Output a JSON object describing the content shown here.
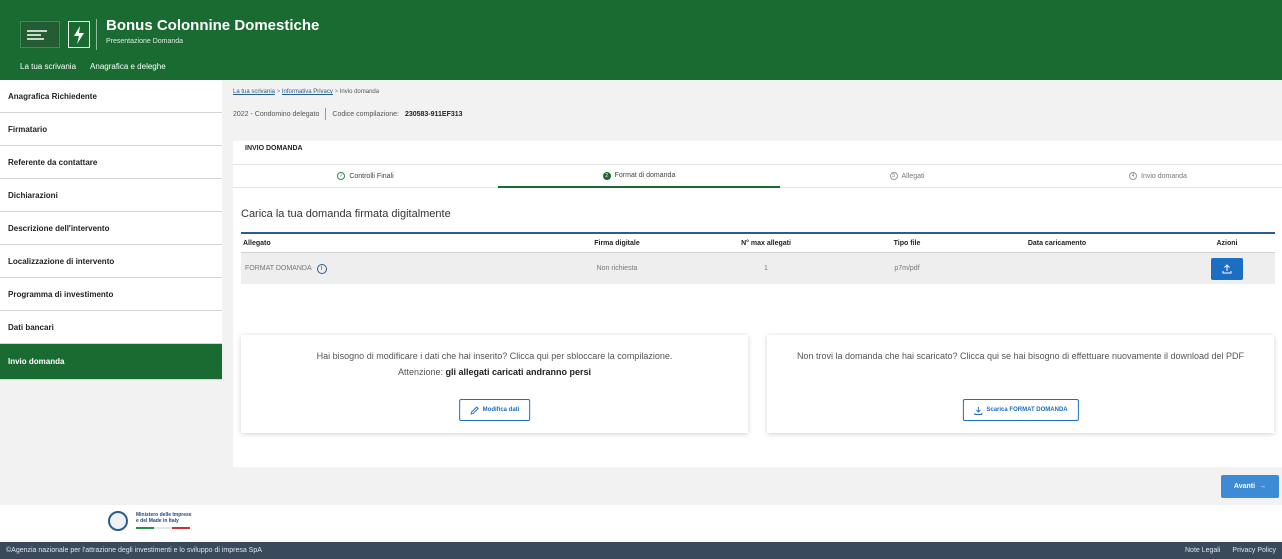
{
  "header": {
    "title": "Bonus Colonnine Domestiche",
    "subtitle": "Presentazione Domanda",
    "nav": [
      "La tua scrivania",
      "Anagrafica e deleghe"
    ]
  },
  "sidebar": {
    "items": [
      {
        "label": "Anagrafica Richiedente"
      },
      {
        "label": "Firmatario"
      },
      {
        "label": "Referente da contattare"
      },
      {
        "label": "Dichiarazioni"
      },
      {
        "label": "Descrizione dell'intervento"
      },
      {
        "label": "Localizzazione di intervento"
      },
      {
        "label": "Programma di investimento"
      },
      {
        "label": "Dati bancari"
      },
      {
        "label": "Invio domanda",
        "active": true
      }
    ]
  },
  "breadcrumb": [
    "La tua scrivania",
    "Informativa Privacy",
    "Invio domanda"
  ],
  "meta": {
    "year_type": "2022 - Condomino delegato",
    "code_label": "Codice compilazione:",
    "code_value": "230583-911EF313"
  },
  "card": {
    "title": "INVIO DOMANDA",
    "steps": [
      {
        "number": "✓",
        "label": "Controlli Finali",
        "state": "done"
      },
      {
        "number": "2",
        "label": "Format di domanda",
        "state": "active"
      },
      {
        "number": "3",
        "label": "Allegati",
        "state": "pending"
      },
      {
        "number": "4",
        "label": "Invio domanda",
        "state": "pending"
      }
    ],
    "upload_title": "Carica la tua domanda firmata digitalmente",
    "table": {
      "headers": [
        "Allegato",
        "Firma digitale",
        "N° max allegati",
        "Tipo file",
        "Data caricamento",
        "Azioni"
      ],
      "row": {
        "allegato": "FORMAT DOMANDA",
        "firma": "Non richiesta",
        "max": "1",
        "tipo": "p7m/pdf",
        "data": ""
      }
    },
    "panel_left": {
      "line1": "Hai bisogno di modificare i dati che hai inserito? Clicca qui per sbloccare la compilazione.",
      "attention": "Attenzione:",
      "attention_bold": "gli allegati caricati andranno persi",
      "button": "Modifica dati"
    },
    "panel_right": {
      "text": "Non trovi la domanda che hai scaricato? Clicca qui se hai bisogno di effettuare nuovamente il download del PDF",
      "button": "Scarica FORMAT DOMANDA"
    }
  },
  "next_button": "Avanti",
  "footer": {
    "ministry_line1": "Ministero delle Imprese",
    "ministry_line2": "e del Made in Italy",
    "copyright": "©Agenzia nazionale per l'attrazione degli investimenti e lo sviluppo di impresa SpA",
    "links": [
      "Note Legali",
      "Privacy Policy"
    ]
  },
  "colors": {
    "brand_green": "#1a6b32",
    "link_blue": "#2b5d8f",
    "primary_blue": "#1b6ec2",
    "footer_dark": "#3a4a5c"
  }
}
